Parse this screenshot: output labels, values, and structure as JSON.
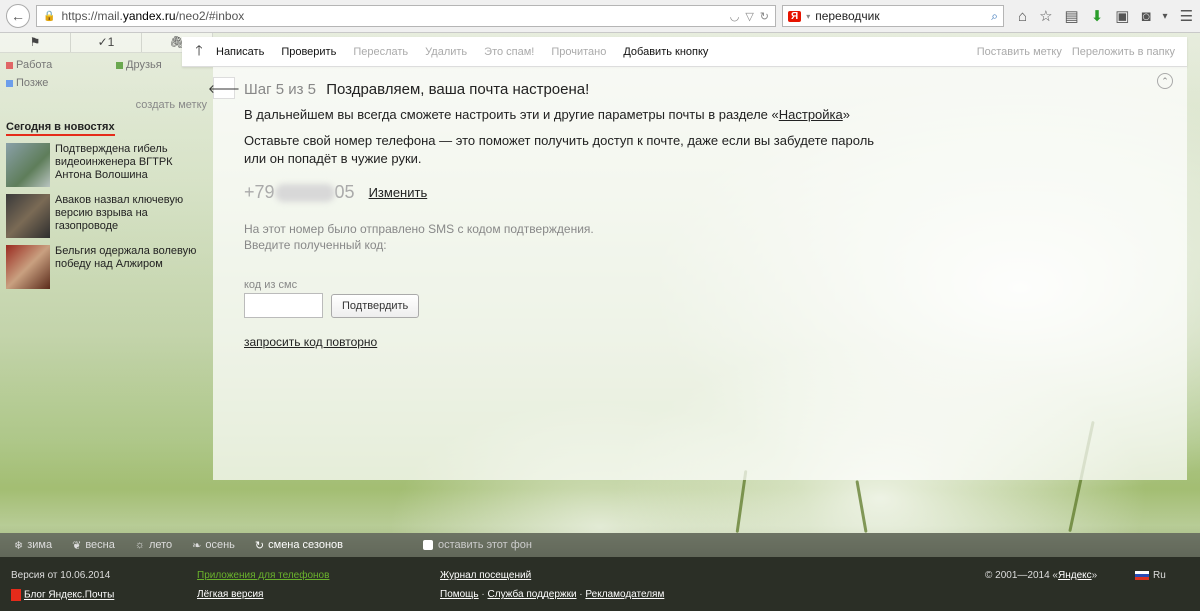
{
  "browser": {
    "url_prefix": "https://mail.",
    "url_domain": "yandex.ru",
    "url_path": "/neo2/#inbox",
    "search_engine_badge": "Я",
    "search_query": "переводчик"
  },
  "left": {
    "top_tabs": [
      "⚑",
      "✓1",
      "🖇"
    ],
    "labels": [
      {
        "name": "Работа",
        "color": "#e06666"
      },
      {
        "name": "Друзья",
        "color": "#6aa84f"
      },
      {
        "name": "Позже",
        "color": "#6d9eeb"
      }
    ],
    "create_label": "создать метку",
    "news_title": "Сегодня в новостях",
    "news": [
      {
        "text": "Подтверждена гибель видеоинженера ВГТРК Антона Волошина"
      },
      {
        "text": "Аваков назвал ключевую версию взрыва на газопроводе"
      },
      {
        "text": "Бельгия одержала волевую победу над Алжиром"
      }
    ]
  },
  "toolbar": {
    "up_arrow": "🡑",
    "compose": "Написать",
    "check": "Проверить",
    "forward": "Переслать",
    "delete": "Удалить",
    "spam": "Это спам!",
    "read": "Прочитано",
    "add_button": "Добавить кнопку",
    "set_label": "Поставить метку",
    "move_to_folder": "Переложить в папку"
  },
  "main": {
    "collapse_arrow": "🡐",
    "step_num": "Шаг 5 из 5",
    "step_title": "Поздравляем, ваша почта настроена!",
    "settings_text_before": "В дальнейшем вы всегда сможете настроить эти и другие параметры почты в разделе «",
    "settings_link": "Настройка",
    "settings_text_after": "»",
    "phone_text": "Оставьте свой номер телефона — это поможет получить доступ к почте, даже если вы забудете пароль или он попадёт в чужие руки.",
    "phone_prefix": "+79",
    "phone_suffix": "05",
    "change_link": "Изменить",
    "sms_sent": "На этот номер было отправлено SMS с кодом подтверждения.",
    "enter_code": "Введите полученный код:",
    "code_label": "код из смс",
    "confirm_button": "Подтвердить",
    "resend": "запросить код повторно"
  },
  "seasons": {
    "winter": "зима",
    "spring": "весна",
    "summer": "лето",
    "autumn": "осень",
    "change": "смена сезонов",
    "keep_bg": "оставить этот фон"
  },
  "footer": {
    "version": "Версия от 10.06.2014",
    "blog": "Блог Яндекс.Почты",
    "apps": "Приложения для телефонов",
    "lite": "Лёгкая версия",
    "journal": "Журнал посещений",
    "help": "Помощь",
    "support": "Служба поддержки",
    "advertisers": "Рекламодателям",
    "copyright_prefix": "© 2001—2014 «",
    "copyright_link": "Яндекс",
    "copyright_suffix": "»",
    "lang": "Ru"
  }
}
